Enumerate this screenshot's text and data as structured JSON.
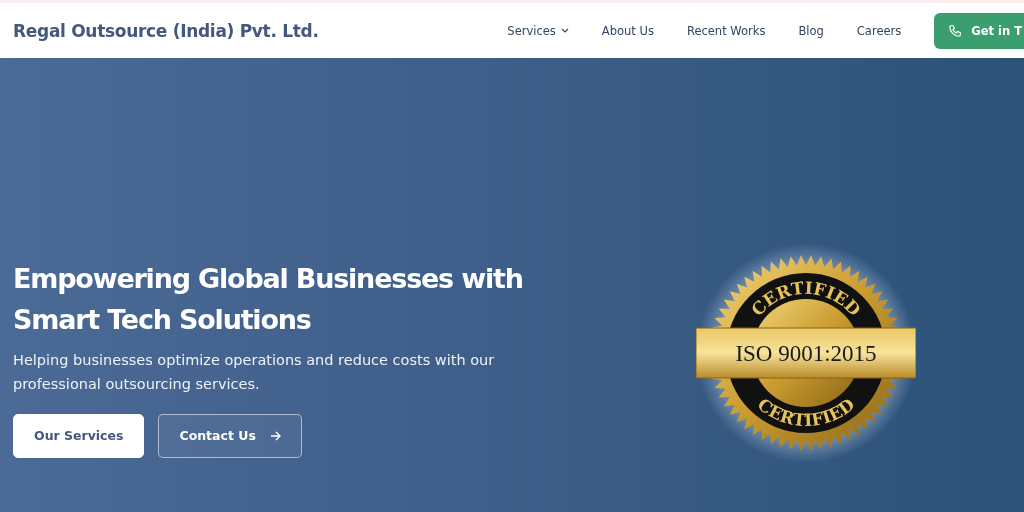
{
  "header": {
    "logo": "Regal Outsource (India) Pvt. Ltd.",
    "nav": [
      {
        "label": "Services",
        "has_dropdown": true
      },
      {
        "label": "About Us",
        "has_dropdown": false
      },
      {
        "label": "Recent Works",
        "has_dropdown": false
      },
      {
        "label": "Blog",
        "has_dropdown": false
      },
      {
        "label": "Careers",
        "has_dropdown": false
      }
    ],
    "cta": "Get in T"
  },
  "hero": {
    "title": "Empowering Global Businesses with Smart Tech Solutions",
    "subtitle": "Helping businesses optimize operations and reduce costs with our professional outsourcing services.",
    "buttons": [
      {
        "label": "Our Services",
        "kind": "primary"
      },
      {
        "label": "Contact Us",
        "kind": "outline"
      }
    ],
    "badge": {
      "top": "CERTIFIED",
      "center": "ISO 9001:2015",
      "bottom": "CERTIFIED"
    }
  }
}
